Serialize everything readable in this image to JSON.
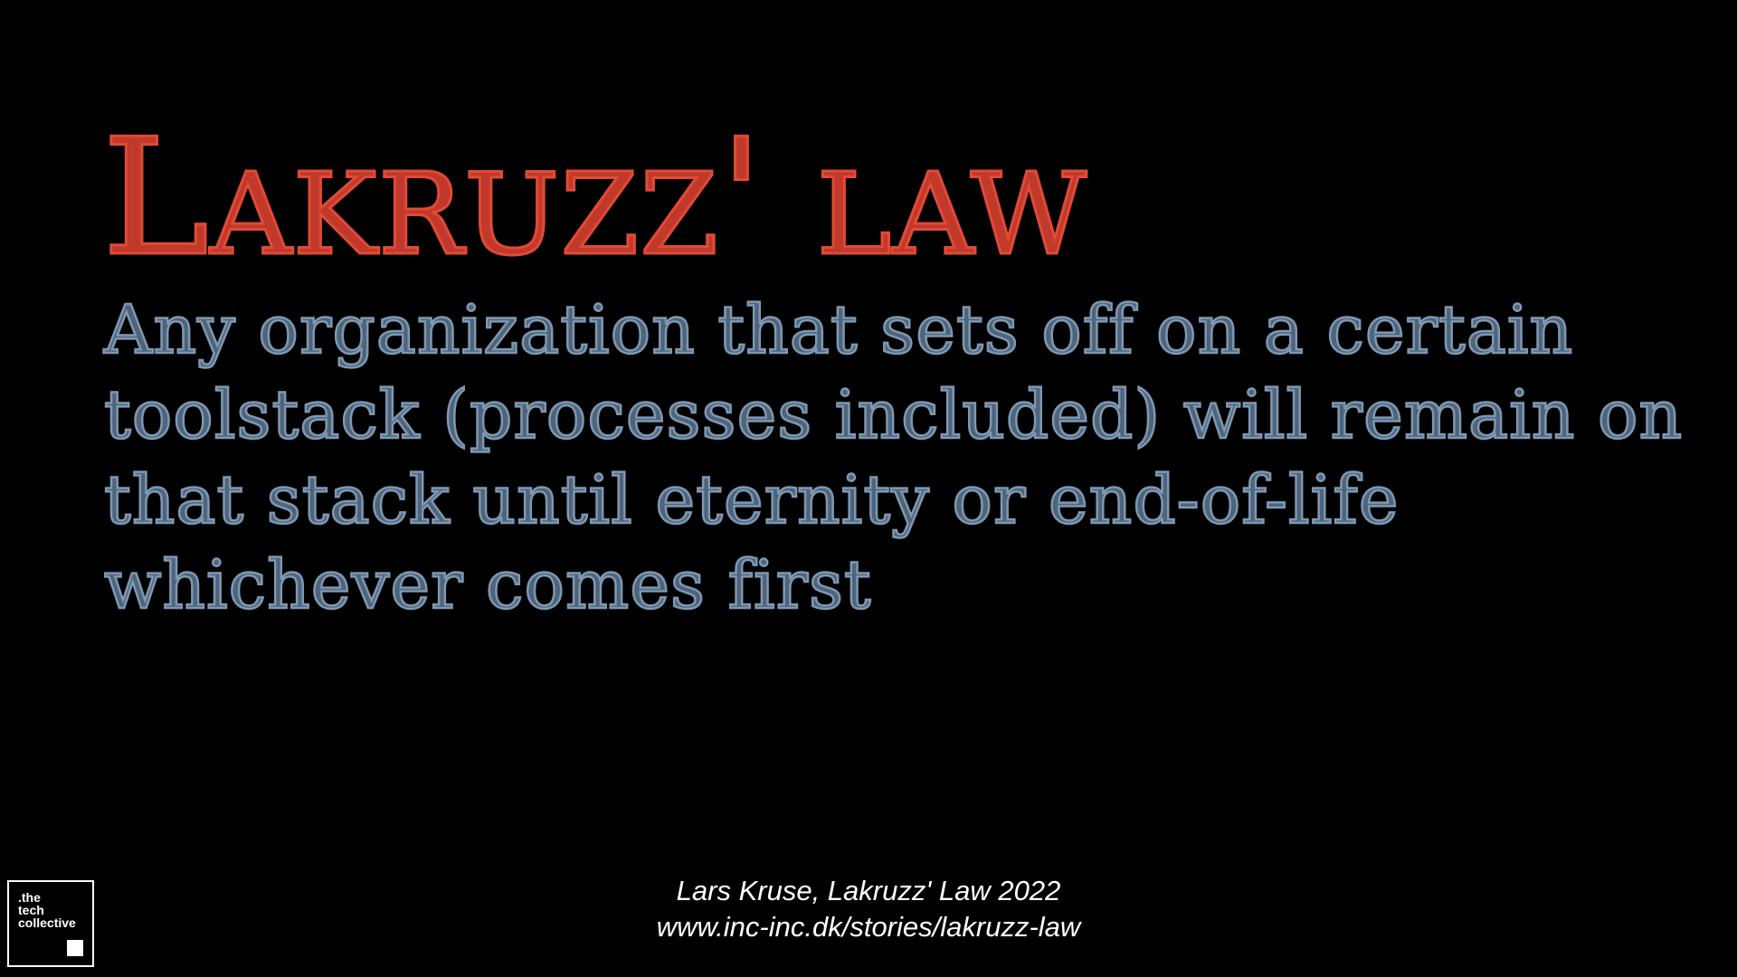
{
  "slide": {
    "title": "Lakruzz' law",
    "body": "Any organization that sets off on a certain toolstack (processes included) will remain on that stack until eternity or end-of-life whichever comes first",
    "citation": {
      "line1": "Lars Kruse, Lakruzz' Law 2022",
      "line2": "www.inc-inc.dk/stories/lakruzz-law"
    },
    "logo": {
      "text": ".the\ntech\ncollective",
      "icon": "square-icon"
    },
    "colors": {
      "background": "#000000",
      "title": "#e24a35",
      "body": "#7d98b3",
      "citation": "#ffffff"
    }
  }
}
